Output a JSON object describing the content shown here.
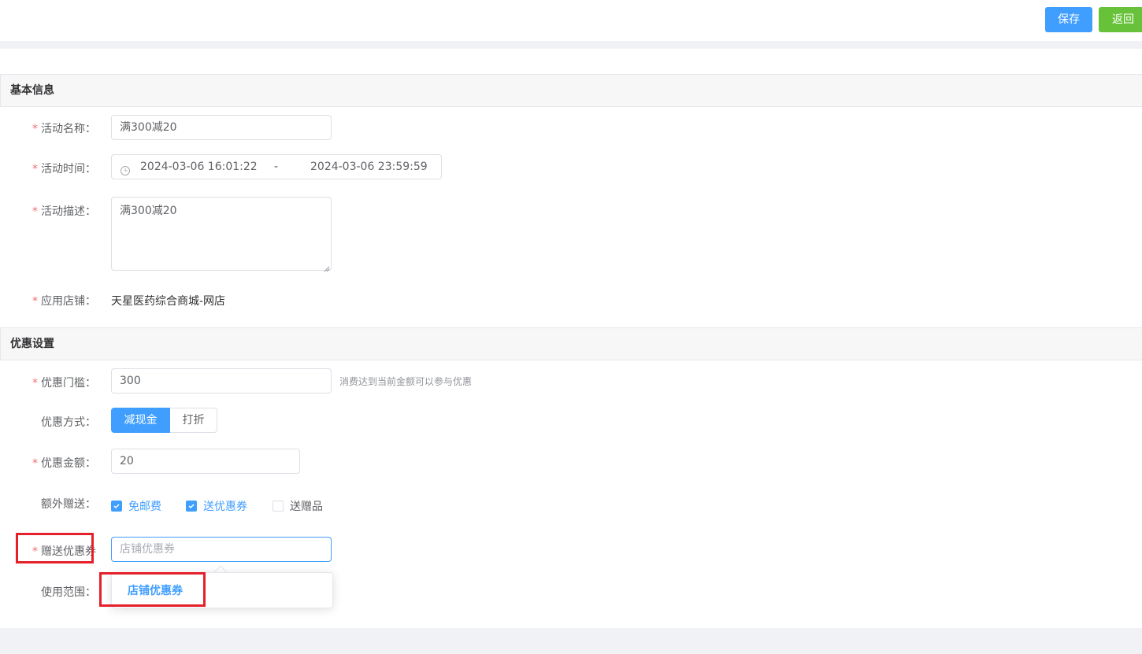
{
  "toolbar": {
    "save_label": "保存",
    "back_label": "返回"
  },
  "sections": {
    "basic": "基本信息",
    "discount": "优惠设置"
  },
  "form": {
    "name": {
      "label": "活动名称：",
      "value": "满300减20"
    },
    "time": {
      "label": "活动时间：",
      "start": "2024-03-06 16:01:22",
      "separator": "-",
      "end": "2024-03-06 23:59:59"
    },
    "desc": {
      "label": "活动描述：",
      "value": "满300减20"
    },
    "store": {
      "label": "应用店铺：",
      "value": "天星医药综合商城-网店"
    },
    "threshold": {
      "label": "优惠门槛：",
      "value": "300",
      "hint": "消费达到当前金额可以参与优惠"
    },
    "mode": {
      "label": "优惠方式：",
      "options": [
        "减现金",
        "打折"
      ],
      "selected": "减现金"
    },
    "amount": {
      "label": "优惠金额：",
      "value": "20"
    },
    "extras": {
      "label": "额外赠送：",
      "options": [
        {
          "label": "免邮费",
          "checked": true
        },
        {
          "label": "送优惠券",
          "checked": true
        },
        {
          "label": "送赠品",
          "checked": false
        }
      ]
    },
    "coupon": {
      "label": "赠送优惠券",
      "placeholder": "店铺优惠券"
    },
    "scope": {
      "label": "使用范围："
    }
  },
  "dropdown": {
    "items": [
      "店铺优惠券"
    ]
  },
  "required_mark": "*",
  "colors": {
    "primary": "#409eff",
    "success": "#67c23a",
    "danger": "#f56c6c",
    "highlight": "#e5202a"
  }
}
